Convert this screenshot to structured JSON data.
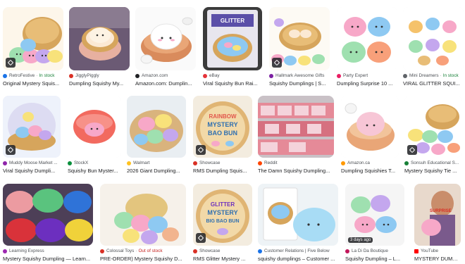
{
  "results": [
    {
      "source": "RetroFestive",
      "stock": "In stock",
      "stock_type": "in",
      "title": "Original Mystery Squis...",
      "fav_color": "#1a73e8",
      "badge": true
    },
    {
      "source": "JigglyPiggly",
      "stock": "",
      "stock_type": "",
      "title": "Dumpling Squishy My...",
      "fav_color": "#d93025",
      "badge": false
    },
    {
      "source": "Amazon.com",
      "stock": "",
      "stock_type": "",
      "title": "Amazon.com: Dumplin...",
      "fav_color": "#202124",
      "badge": false
    },
    {
      "source": "eBay",
      "stock": "",
      "stock_type": "",
      "title": "Viral Squishy Bun Rai...",
      "fav_color": "#e53238",
      "badge": false
    },
    {
      "source": "Hallmark Awesome Gifts",
      "stock": "",
      "stock_type": "",
      "title": "Squishy Dumplings | S...",
      "fav_color": "#7b1fa2",
      "badge": true
    },
    {
      "source": "Party Expert",
      "stock": "",
      "stock_type": "",
      "title": "Dumpling Surprise 10 ...",
      "fav_color": "#e91e63",
      "badge": false
    },
    {
      "source": "Mini Dreamers",
      "stock": "In stock",
      "stock_type": "in",
      "title": "VIRAL GLITTER SQUI...",
      "fav_color": "#5f6368",
      "badge": false
    },
    {
      "source": "Muddy Moose Market ...",
      "stock": "",
      "stock_type": "",
      "title": "Viral Squishy Dumpli...",
      "fav_color": "#8e24aa",
      "badge": true
    },
    {
      "source": "StockX",
      "stock": "",
      "stock_type": "",
      "title": "Squishy Bun Myster...",
      "fav_color": "#0a8f3c",
      "badge": false
    },
    {
      "source": "Walmart",
      "stock": "",
      "stock_type": "",
      "title": "2026 Giant Dumpling...",
      "fav_color": "#ffc220",
      "badge": false
    },
    {
      "source": "Showcase",
      "stock": "",
      "stock_type": "",
      "title": "RMS Dumpling Squis...",
      "fav_color": "#d93025",
      "badge": true
    },
    {
      "source": "Reddit",
      "stock": "",
      "stock_type": "",
      "title": "The Damn Squishy Dumpling...",
      "fav_color": "#ff4500",
      "badge": false
    },
    {
      "source": "Amazon.ca",
      "stock": "",
      "stock_type": "",
      "title": "Dumpling Squishies T...",
      "fav_color": "#ff9900",
      "badge": false
    },
    {
      "source": "Sonsuh Educational S...",
      "stock": "",
      "stock_type": "",
      "title": "Mystery Squishy Tie ...",
      "fav_color": "#188038",
      "badge": true
    },
    {
      "source": "Learning Express",
      "stock": "",
      "stock_type": "",
      "title": "Mystery Squishy Dumpling — Learn...",
      "fav_color": "#9c27b0",
      "badge": false
    },
    {
      "source": "Colossal Toys",
      "stock": "Out of stock",
      "stock_type": "out",
      "title": "PRE-ORDER) Mystery Squishy D...",
      "fav_color": "#d93025",
      "badge": false
    },
    {
      "source": "Showcase",
      "stock": "",
      "stock_type": "",
      "title": "RMS Glitter Mystery ...",
      "fav_color": "#d93025",
      "badge": true
    },
    {
      "source": "Customer Relations | Five Below",
      "stock": "",
      "stock_type": "",
      "title": "squishy dumplings – Customer ...",
      "fav_color": "#1a73e8",
      "badge": false
    },
    {
      "source": "La Di Da Boutique",
      "stock": "",
      "stock_type": "",
      "title": "Squishy Dumpling – L...",
      "fav_color": "#c2185b",
      "badge": false,
      "ago": "3 days ago"
    },
    {
      "source": "YouTube",
      "stock": "",
      "stock_type": "",
      "title": "MYSTERY DUMPL...",
      "fav_color": "#ff0000",
      "badge": false
    }
  ],
  "thumb_text": {
    "r4": "GLITTER",
    "r10a": "RAINBOW",
    "r10b": "MYSTERY",
    "r10c": "BAO BUN",
    "r16a": "GLITTER",
    "r16b": "MYSTERY",
    "r16c": "BIG BAO BUN",
    "r19": "SURPRISE"
  },
  "colors": {
    "steamer": "#d6a55c",
    "steamer_dark": "#b9853e",
    "pink": "#f7a8c8",
    "blue": "#8ec9f2",
    "yellow": "#f8e27a",
    "green": "#9fe0b0",
    "purple": "#c4a7ee",
    "cream": "#fbe9d4",
    "red_lid": "#f26a5f"
  }
}
